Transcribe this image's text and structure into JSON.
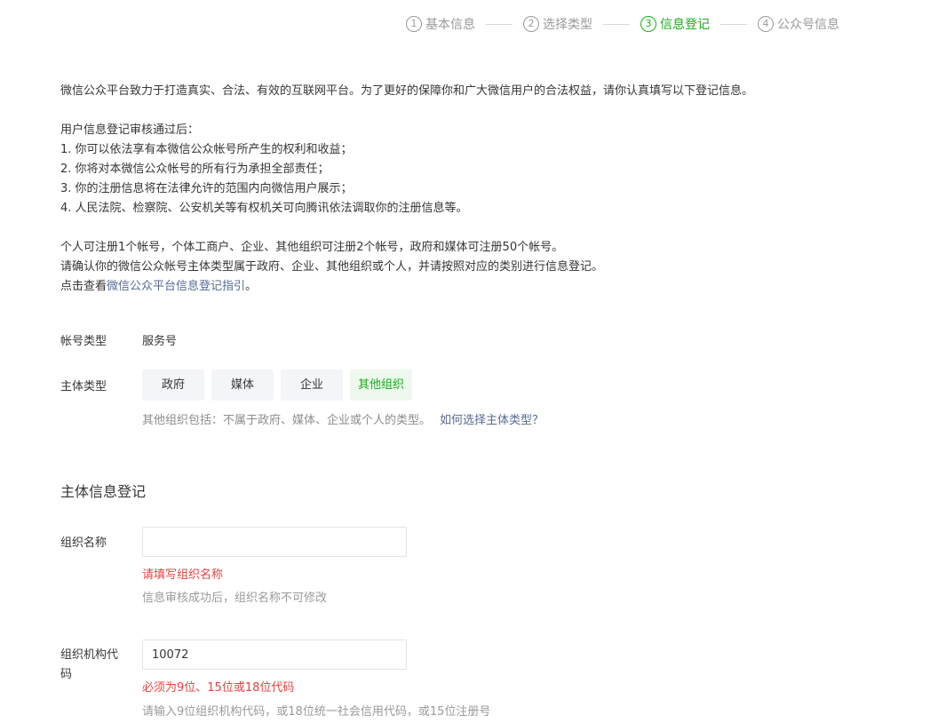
{
  "stepper": {
    "steps": [
      {
        "num": "1",
        "label": "基本信息",
        "active": false
      },
      {
        "num": "2",
        "label": "选择类型",
        "active": false
      },
      {
        "num": "3",
        "label": "信息登记",
        "active": true
      },
      {
        "num": "4",
        "label": "公众号信息",
        "active": false
      }
    ]
  },
  "intro": {
    "line1": "微信公众平台致力于打造真实、合法、有效的互联网平台。为了更好的保障你和广大微信用户的合法权益，请你认真填写以下登记信息。",
    "after_title": "用户信息登记审核通过后：",
    "items": [
      "1. 你可以依法享有本微信公众帐号所产生的权利和收益；",
      "2. 你将对本微信公众帐号的所有行为承担全部责任；",
      "3. 你的注册信息将在法律允许的范围内向微信用户展示；",
      "4. 人民法院、检察院、公安机关等有权机关可向腾讯依法调取你的注册信息等。"
    ],
    "quota": "个人可注册1个帐号，个体工商户、企业、其他组织可注册2个帐号，政府和媒体可注册50个帐号。",
    "confirm": "请确认你的微信公众帐号主体类型属于政府、企业、其他组织或个人，并请按照对应的类别进行信息登记。",
    "guide_prefix": "点击查看",
    "guide_link": "微信公众平台信息登记指引",
    "guide_suffix": "。"
  },
  "account_type": {
    "label": "帐号类型",
    "value": "服务号"
  },
  "subject_type": {
    "label": "主体类型",
    "options": [
      "政府",
      "媒体",
      "企业",
      "其他组织"
    ],
    "selected": "其他组织",
    "hint": "其他组织包括：不属于政府、媒体、企业或个人的类型。",
    "help_link": "如何选择主体类型？"
  },
  "section_title": "主体信息登记",
  "org_name": {
    "label": "组织名称",
    "value": "",
    "placeholder": "",
    "error": "请填写组织名称",
    "tip": "信息审核成功后，组织名称不可修改"
  },
  "org_code": {
    "label_line1": "组织机构代",
    "label_line2": "码",
    "value": "10072",
    "error": "必须为9位、15位或18位代码",
    "tip": "请输入9位组织机构代码，或18位统一社会信用代码，或15位注册号"
  },
  "colors": {
    "accent": "#1aad19",
    "error": "#e64340",
    "link": "#576b95"
  }
}
